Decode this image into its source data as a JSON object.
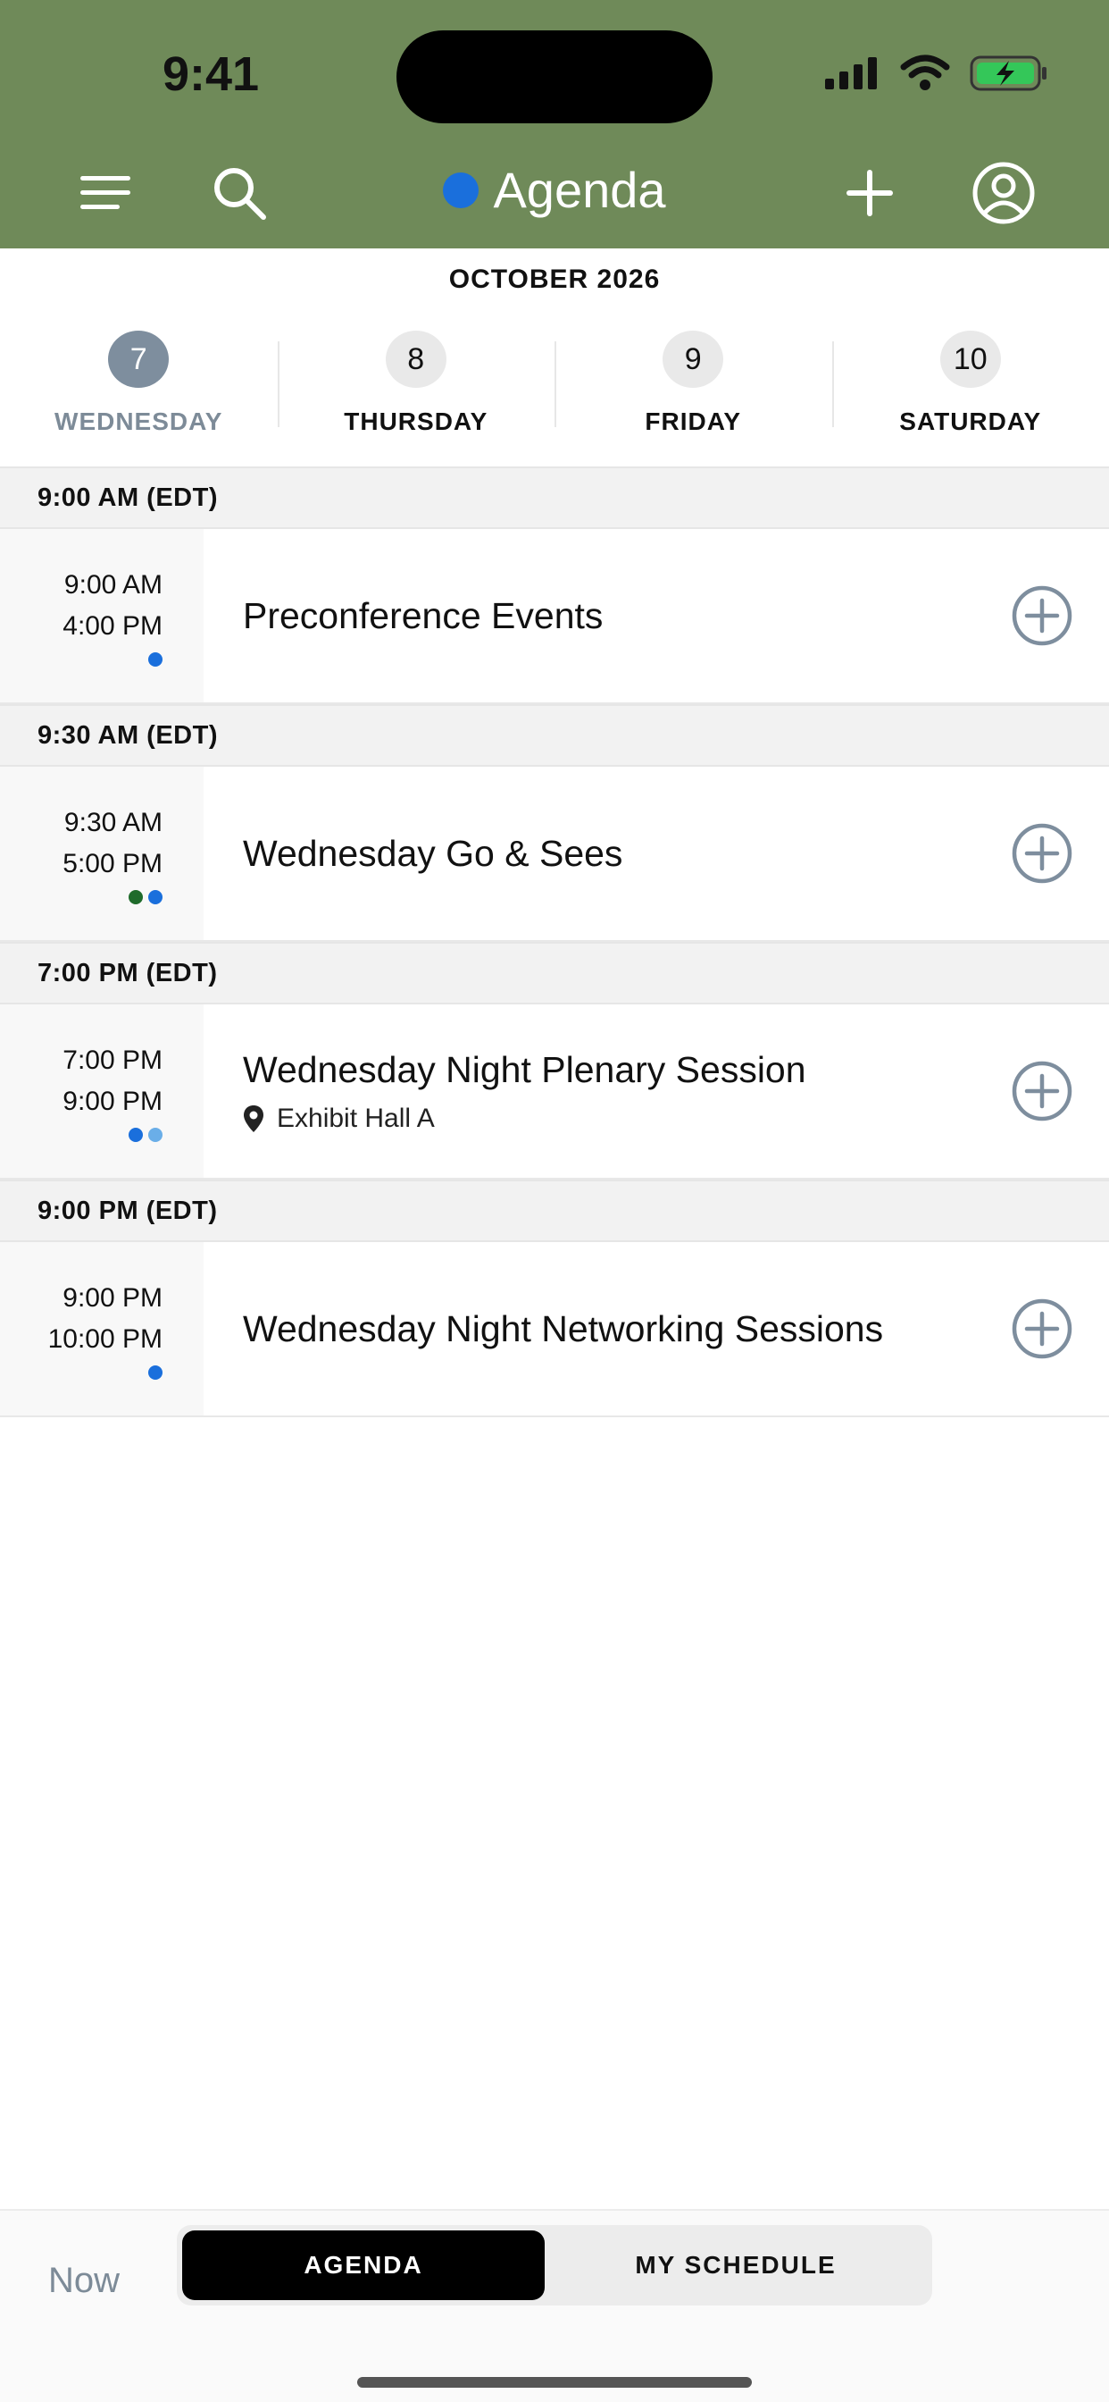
{
  "status": {
    "time": "9:41"
  },
  "nav": {
    "title": "Agenda",
    "title_dot_color": "#1a6fdc"
  },
  "calendar": {
    "month": "OCTOBER 2026",
    "days": [
      {
        "num": "7",
        "name": "WEDNESDAY",
        "selected": true
      },
      {
        "num": "8",
        "name": "THURSDAY",
        "selected": false
      },
      {
        "num": "9",
        "name": "FRIDAY",
        "selected": false
      },
      {
        "num": "10",
        "name": "SATURDAY",
        "selected": false
      }
    ]
  },
  "sections": [
    {
      "header": "9:00 AM (EDT)",
      "event": {
        "start": "9:00 AM",
        "end": "4:00 PM",
        "title": "Preconference Events",
        "location": "",
        "dots": [
          "#1a6fdc"
        ]
      }
    },
    {
      "header": "9:30 AM (EDT)",
      "event": {
        "start": "9:30 AM",
        "end": "5:00 PM",
        "title": "Wednesday Go & Sees",
        "location": "",
        "dots": [
          "#1f6b2b",
          "#1a6fdc"
        ]
      }
    },
    {
      "header": "7:00 PM (EDT)",
      "event": {
        "start": "7:00 PM",
        "end": "9:00 PM",
        "title": "Wednesday Night Plenary Session",
        "location": "Exhibit Hall A",
        "dots": [
          "#1a6fdc",
          "#6aaee8"
        ]
      }
    },
    {
      "header": "9:00 PM (EDT)",
      "event": {
        "start": "9:00 PM",
        "end": "10:00 PM",
        "title": "Wednesday Night Networking Sessions",
        "location": "",
        "dots": [
          "#1a6fdc"
        ]
      }
    }
  ],
  "bottom": {
    "now": "Now",
    "agenda": "AGENDA",
    "my_schedule": "MY SCHEDULE"
  }
}
